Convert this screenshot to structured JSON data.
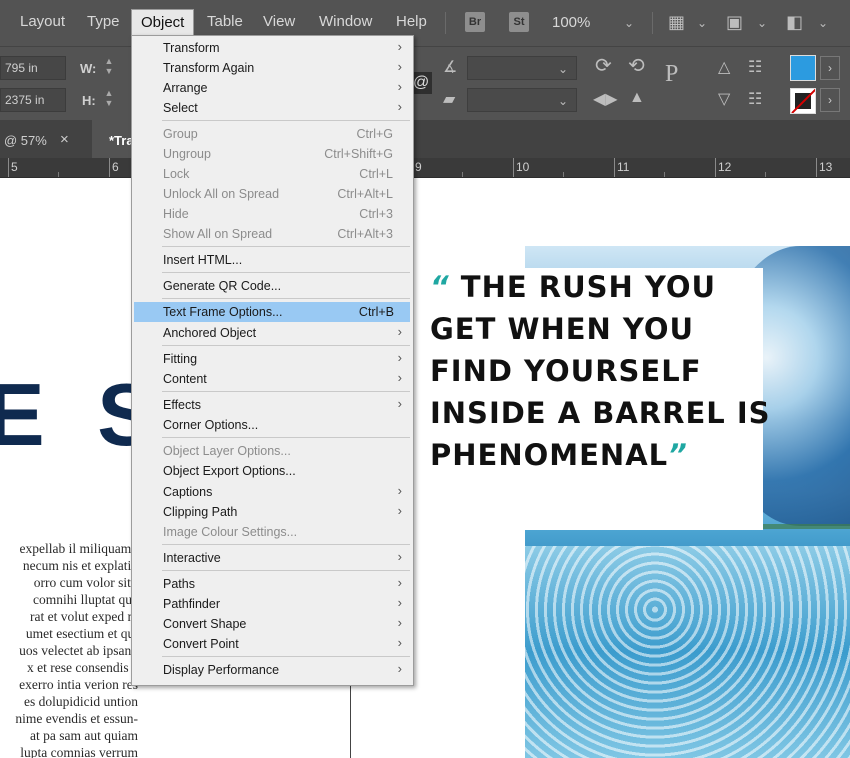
{
  "menubar": {
    "items": [
      "Layout",
      "Type",
      "Object",
      "Table",
      "View",
      "Window",
      "Help"
    ],
    "badges": [
      "Br",
      "St"
    ],
    "zoom": "100%"
  },
  "control": {
    "x_value": "795 in",
    "y_value": "2375 in",
    "w_label": "W:",
    "h_label": "H:"
  },
  "tabs": {
    "tab1": "@ 57%",
    "tab1_close": "×",
    "tab2": "*Tra"
  },
  "ruler": [
    "5",
    "6",
    "9",
    "10",
    "11",
    "12",
    "13"
  ],
  "canvas": {
    "headline_letters": "E S",
    "body_lines": [
      "expellab il miliquamu",
      "necum nis et explatio",
      "orro cum volor sit l",
      "comnihi lluptat qua",
      "rat et volut exped m",
      "umet esectium et qui",
      "uos velectet ab ipsand",
      "x et rese consendis e",
      "exerro intia verion res",
      "es dolupidicid untion",
      "nime evendis et essun-",
      "at pa sam aut quiam",
      "lupta comnias verrum"
    ],
    "quote_open": "“",
    "quote_lines": [
      "THE RUSH YOU",
      "GET WHEN YOU",
      "FIND YOURSELF",
      "INSIDE A BARREL IS",
      "PHENOMENAL"
    ],
    "quote_close": "”",
    "accent_color": "#1fa7a2"
  },
  "object_menu": {
    "items": [
      {
        "label": "Transform",
        "submenu": true
      },
      {
        "label": "Transform Again",
        "submenu": true
      },
      {
        "label": "Arrange",
        "submenu": true
      },
      {
        "label": "Select",
        "submenu": true
      },
      {
        "label": "Group",
        "shortcut": "Ctrl+G",
        "disabled": true
      },
      {
        "label": "Ungroup",
        "shortcut": "Ctrl+Shift+G",
        "disabled": true
      },
      {
        "label": "Lock",
        "shortcut": "Ctrl+L",
        "disabled": true
      },
      {
        "label": "Unlock All on Spread",
        "shortcut": "Ctrl+Alt+L",
        "disabled": true
      },
      {
        "label": "Hide",
        "shortcut": "Ctrl+3",
        "disabled": true
      },
      {
        "label": "Show All on Spread",
        "shortcut": "Ctrl+Alt+3",
        "disabled": true
      },
      {
        "label": "Insert HTML..."
      },
      {
        "label": "Generate QR Code..."
      },
      {
        "label": "Text Frame Options...",
        "shortcut": "Ctrl+B",
        "highlighted": true
      },
      {
        "label": "Anchored Object",
        "submenu": true
      },
      {
        "label": "Fitting",
        "submenu": true
      },
      {
        "label": "Content",
        "submenu": true
      },
      {
        "label": "Effects",
        "submenu": true
      },
      {
        "label": "Corner Options..."
      },
      {
        "label": "Object Layer Options...",
        "disabled": true
      },
      {
        "label": "Object Export Options..."
      },
      {
        "label": "Captions",
        "submenu": true
      },
      {
        "label": "Clipping Path",
        "submenu": true
      },
      {
        "label": "Image Colour Settings...",
        "disabled": true
      },
      {
        "label": "Interactive",
        "submenu": true
      },
      {
        "label": "Paths",
        "submenu": true
      },
      {
        "label": "Pathfinder",
        "submenu": true
      },
      {
        "label": "Convert Shape",
        "submenu": true
      },
      {
        "label": "Convert Point",
        "submenu": true
      },
      {
        "label": "Display Performance",
        "submenu": true
      }
    ],
    "highlight_color": "#99c9f3"
  }
}
